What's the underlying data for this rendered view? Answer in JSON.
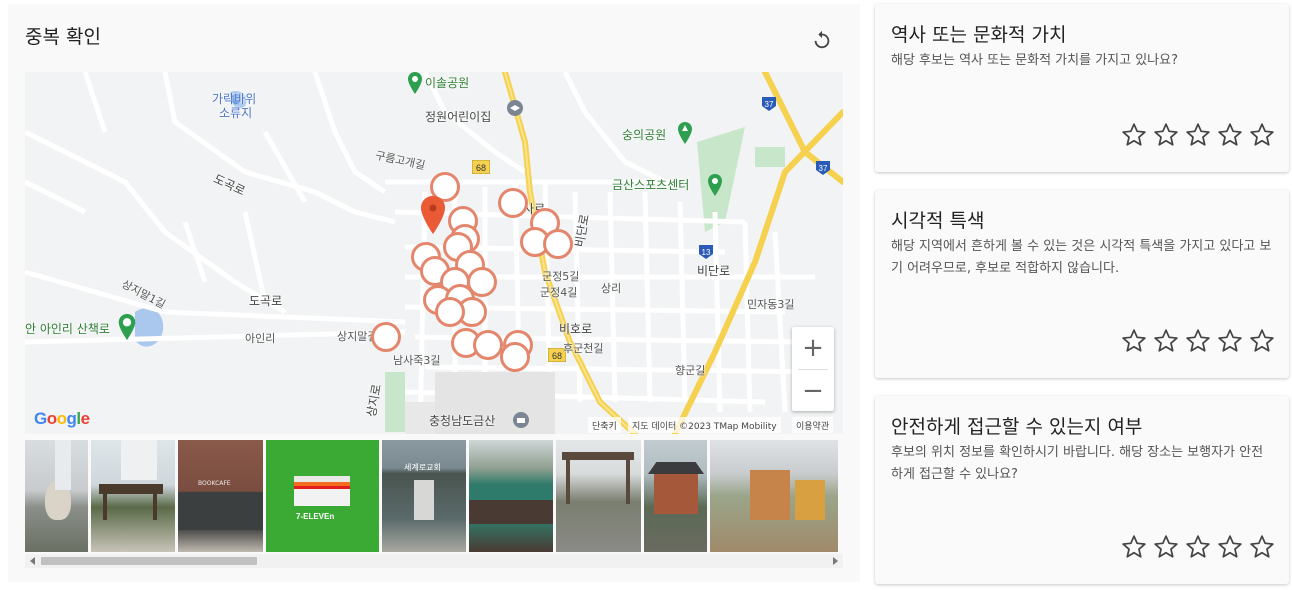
{
  "duplicate_check": {
    "title": "중복 확인",
    "refresh_icon": "refresh-icon"
  },
  "map": {
    "labels": {
      "park1": "이솔공원",
      "park2": "숭의공원",
      "playground": "정원어린이집",
      "sports": "금산스포츠센터",
      "reservoir1": "가락바위",
      "reservoir2": "소류지",
      "trail": "안 아인리 산책로",
      "gov": "충청남도금산",
      "road_docok": "도곡로",
      "road_docok2": "도곡로",
      "road_bidan": "비단로",
      "road_bidan2": "비단로",
      "road_biho": "비호로",
      "road_hosa": "호사로",
      "road_sangji": "상지말길",
      "road_sangji1": "상지말1길",
      "road_ain": "아인리",
      "road_sangjiro": "상지로",
      "road_gunjeong": "군정5길",
      "road_gunjeong4": "군정4길",
      "road_sangni": "상리",
      "road_hugun": "후군천길",
      "road_gureuk": "구름고개길",
      "road_mandong": "민자동3길",
      "road_hyanggun": "향군길",
      "road_namsa": "남사죽3길"
    },
    "route_badges": [
      "68",
      "68",
      "13",
      "37",
      "37"
    ],
    "zoom_in": "+",
    "zoom_out": "−",
    "logo": "Google",
    "attrib_shortcuts": "단축키",
    "attrib_data": "지도 데이터 ©2023 TMap Mobility",
    "attrib_terms": "이용약관"
  },
  "thumbnails": [
    {
      "name": "sculpture-park"
    },
    {
      "name": "pavilion-apartment"
    },
    {
      "name": "book-cafe"
    },
    {
      "name": "seven-eleven",
      "text": "7-ELEVEn"
    },
    {
      "name": "church",
      "text": "세계로교회"
    },
    {
      "name": "basketball-court"
    },
    {
      "name": "wooden-shelter"
    },
    {
      "name": "korean-pavilion"
    },
    {
      "name": "playground"
    }
  ],
  "cards": [
    {
      "title": "역사 또는 문화적 가치",
      "desc": "해당 후보는 역사 또는 문화적 가치를 가지고 있나요?",
      "rating": 0
    },
    {
      "title": "시각적 특색",
      "desc": "해당 지역에서 흔하게 볼 수 있는 것은 시각적 특색을 가지고 있다고 보기 어려우므로, 후보로 적합하지 않습니다.",
      "rating": 0
    },
    {
      "title": "안전하게 접근할 수 있는지 여부",
      "desc": "후보의 위치 정보를 확인하시기 바랍니다. 해당 장소는 보행자가 안전하게 접근할 수 있나요?",
      "rating": 0
    }
  ],
  "colors": {
    "marker_outline": "#e3866c",
    "main_marker": "#ea5a35",
    "road_major": "#f5d14f",
    "park_green": "#c8e6c9"
  }
}
